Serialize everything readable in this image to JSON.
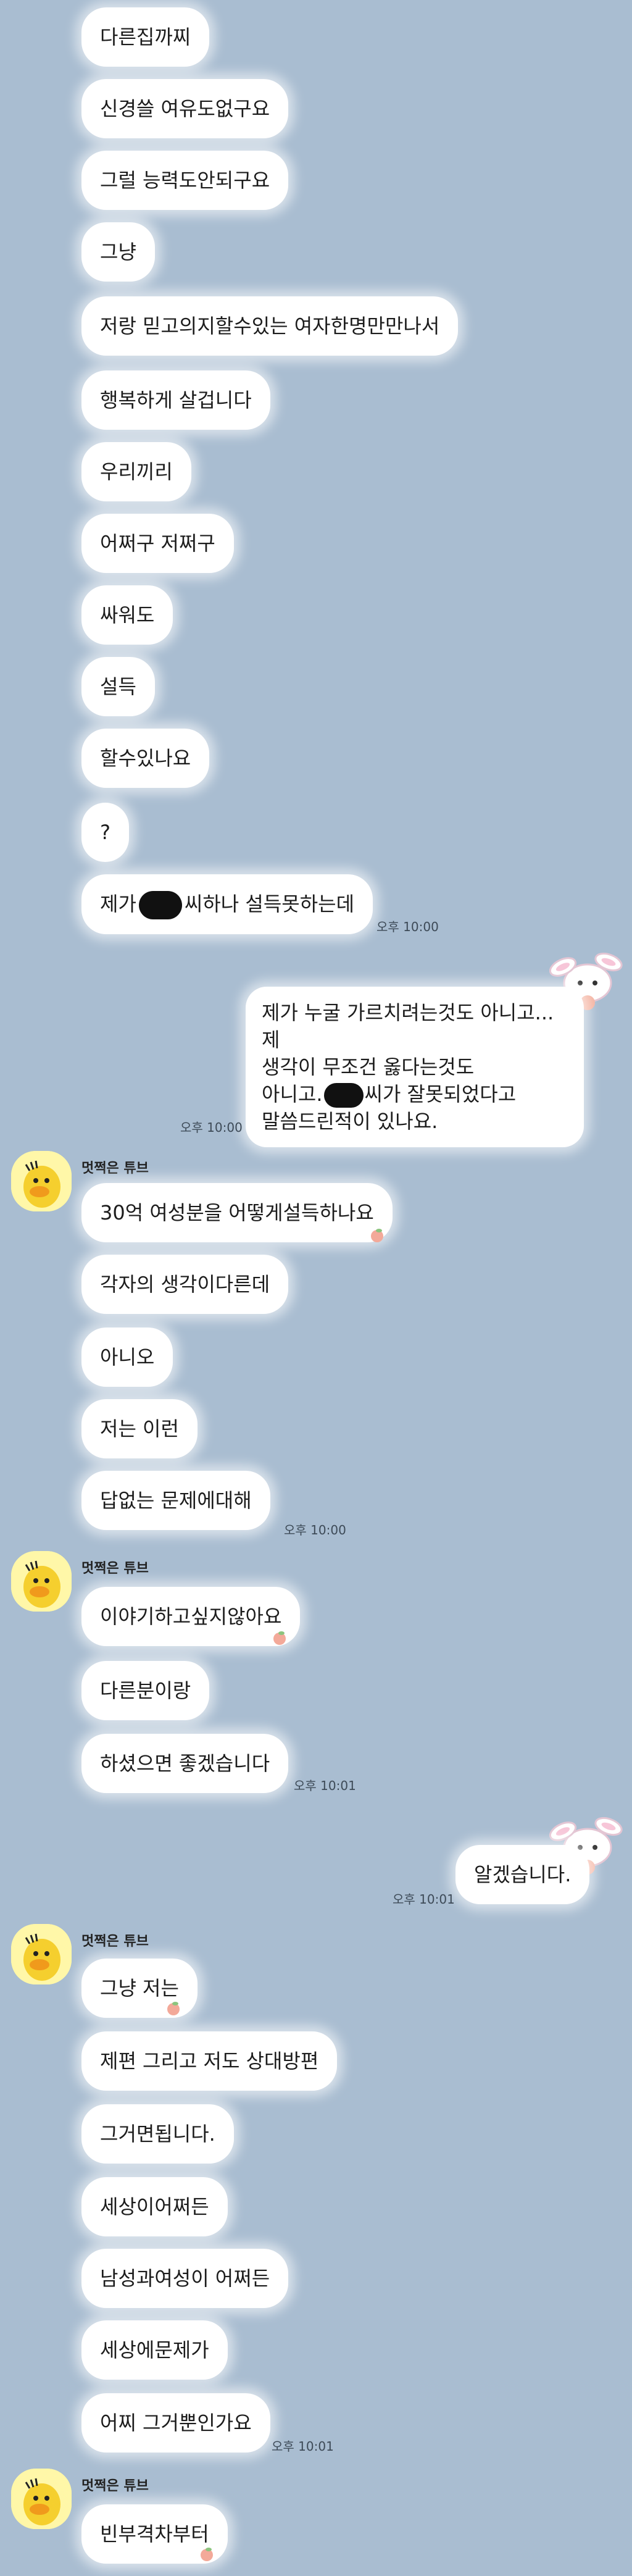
{
  "messages": {
    "m1": "다른집까찌",
    "m2": "신경쓸 여유도없구요",
    "m3": "그럴 능력도안되구요",
    "m4": "그냥",
    "m5": "저랑 믿고의지할수있는 여자한명만만나서",
    "m6": "행복하게 살겁니다",
    "m7": "우리끼리",
    "m8": "어쩌구 저쩌구",
    "m9": "싸워도",
    "m10": "설득",
    "m11": "할수있나요",
    "m12": "?",
    "m13a": "제가",
    "m13b": "씨하나 설득못하는데",
    "t1": "오후 10:00",
    "r1_line1": "제가 누굴 가르치려는것도 아니고...제",
    "r1_line2": "생각이 무조건 옳다는것도",
    "r1_line3a": "아니고.",
    "r1_line3b": "씨가 잘못되었다고",
    "r1_line4": "말씀드린적이 있나요.",
    "t2": "오후 10:00",
    "sender_name": "멋쩍은 튜브",
    "g1_1": "30억 여성분을 어떻게설득하나요",
    "g1_2": "각자의 생각이다른데",
    "g1_3": "아니오",
    "g1_4": "저는 이런",
    "g1_5": "답없는 문제에대해",
    "t3": "오후 10:00",
    "g2_1": "이야기하고싶지않아요",
    "g2_2": "다른분이랑",
    "g2_3": "하셨으면 좋겠습니다",
    "t4": "오후 10:01",
    "r2": "알겠습니다.",
    "t5": "오후 10:01",
    "g3_1": "그냥 저는",
    "g3_2": "제편 그리고 저도 상대방편",
    "g3_3": "그거면됩니다.",
    "g3_4": "세상이어쩌든",
    "g3_5": "남성과여성이 어쩌든",
    "g3_6": "세상에문제가",
    "g3_7": "어찌 그거뿐인가요",
    "t6": "오후 10:01",
    "g4_1": "빈부격차부터"
  },
  "colors": {
    "background": "#a9bdd1",
    "bubble": "#ffffff",
    "avatar": "#fff7a8"
  },
  "icons": {
    "avatar": "tube-duck-avatar",
    "sticker": "bunny-sticker",
    "reaction": "peach-reaction-icon"
  }
}
